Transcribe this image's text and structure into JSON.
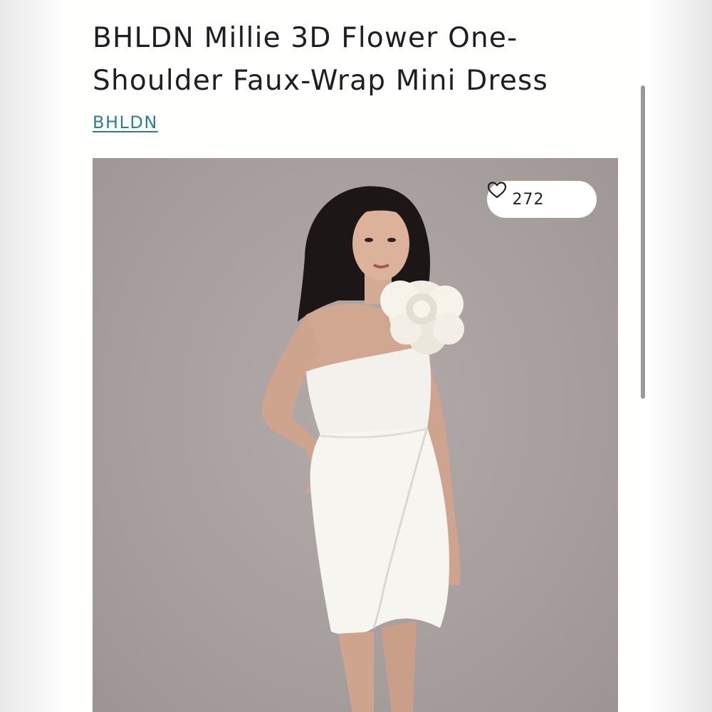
{
  "product": {
    "title": "BHLDN Millie 3D Flower One-Shoulder Faux-Wrap Mini Dress",
    "brand_link": "BHLDN"
  },
  "photo": {
    "like_count": "272",
    "like_icon": "heart-outline-icon"
  },
  "colors": {
    "link": "#2f7f93",
    "title_text": "#1d1f24",
    "photo_background": "#a89f9f"
  }
}
